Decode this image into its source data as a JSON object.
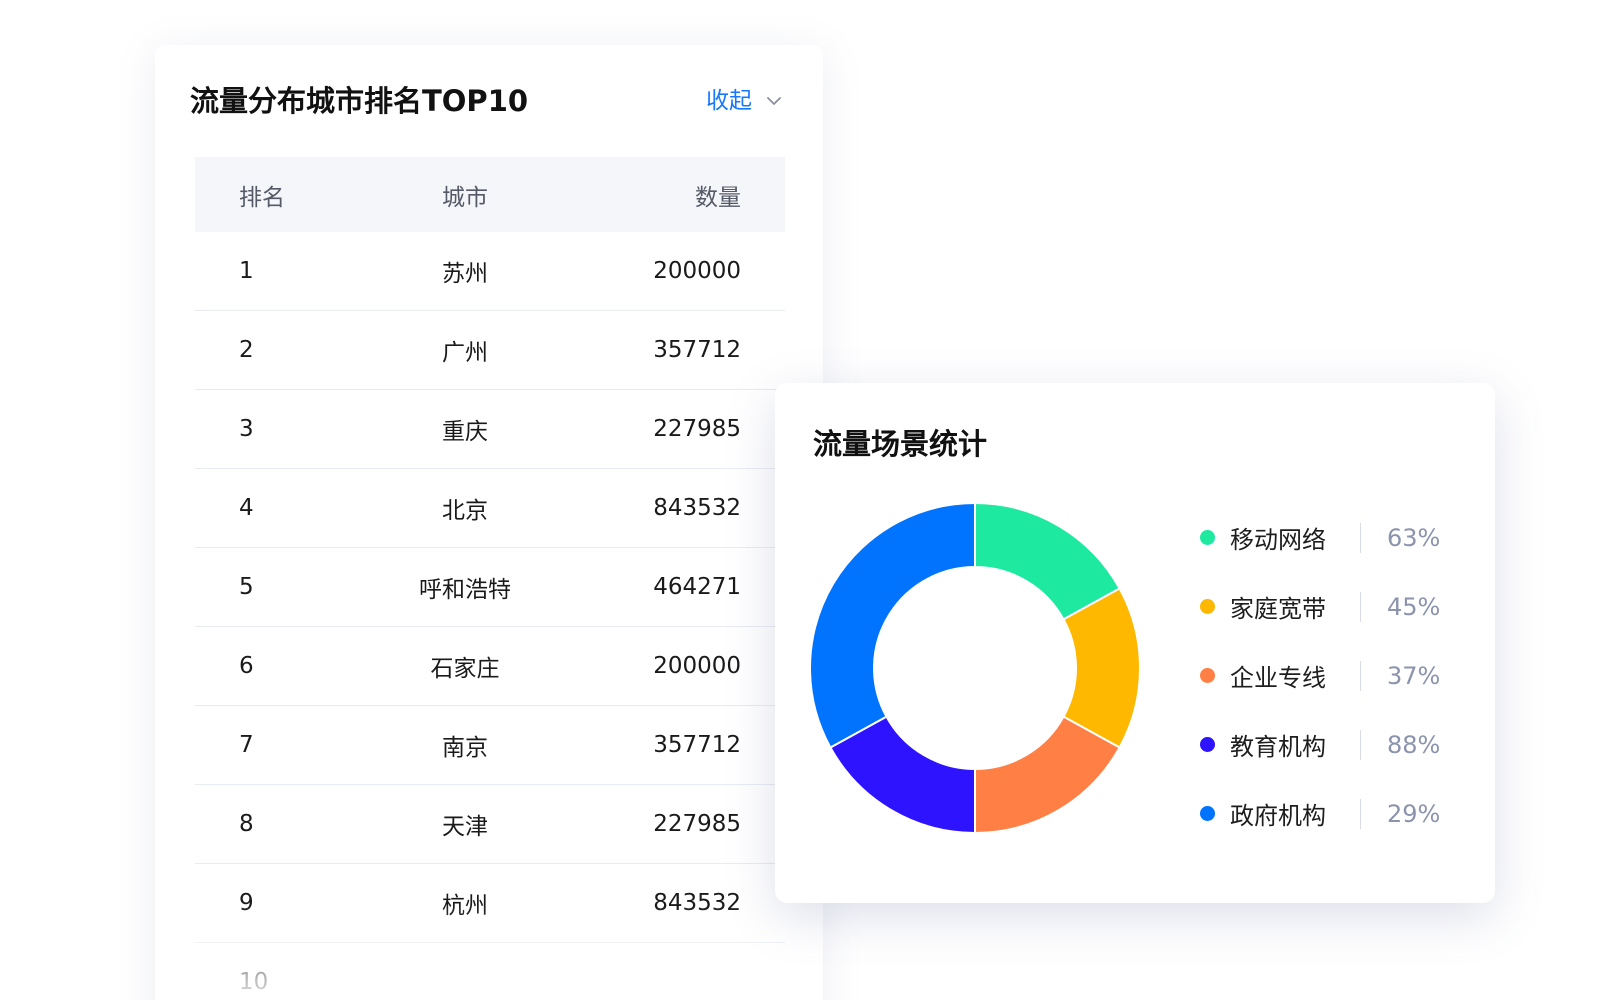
{
  "ranking": {
    "title": "流量分布城市排名TOP10",
    "collapse_label": "收起",
    "columns": {
      "rank": "排名",
      "city": "城市",
      "count": "数量"
    },
    "rows": [
      {
        "rank": "1",
        "city": "苏州",
        "count": "200000"
      },
      {
        "rank": "2",
        "city": "广州",
        "count": "357712"
      },
      {
        "rank": "3",
        "city": "重庆",
        "count": "227985"
      },
      {
        "rank": "4",
        "city": "北京",
        "count": "843532"
      },
      {
        "rank": "5",
        "city": "呼和浩特",
        "count": "464271"
      },
      {
        "rank": "6",
        "city": "石家庄",
        "count": "200000"
      },
      {
        "rank": "7",
        "city": "南京",
        "count": "357712"
      },
      {
        "rank": "8",
        "city": "天津",
        "count": "227985"
      },
      {
        "rank": "9",
        "city": "杭州",
        "count": "843532"
      },
      {
        "rank": "10",
        "city": "",
        "count": ""
      }
    ],
    "accent_color": "#1677ff"
  },
  "scene_stats": {
    "title": "流量场景统计",
    "legend": [
      {
        "label": "移动网络",
        "value": "63%",
        "color": "#1de9a0"
      },
      {
        "label": "家庭宽带",
        "value": "45%",
        "color": "#ffb800"
      },
      {
        "label": "企业专线",
        "value": "37%",
        "color": "#ff7f45"
      },
      {
        "label": "教育机构",
        "value": "88%",
        "color": "#2d13ff"
      },
      {
        "label": "政府机构",
        "value": "29%",
        "color": "#0073ff"
      }
    ]
  },
  "chart_data": {
    "type": "pie",
    "title": "流量场景统计",
    "categories": [
      "移动网络",
      "家庭宽带",
      "企业专线",
      "教育机构",
      "政府机构"
    ],
    "values": [
      63,
      45,
      37,
      88,
      29
    ],
    "colors": [
      "#1de9a0",
      "#ffb800",
      "#ff7f45",
      "#2d13ff",
      "#0073ff"
    ],
    "slice_shares": [
      0.17,
      0.16,
      0.17,
      0.17,
      0.33
    ],
    "legend": "right",
    "donut": true
  }
}
